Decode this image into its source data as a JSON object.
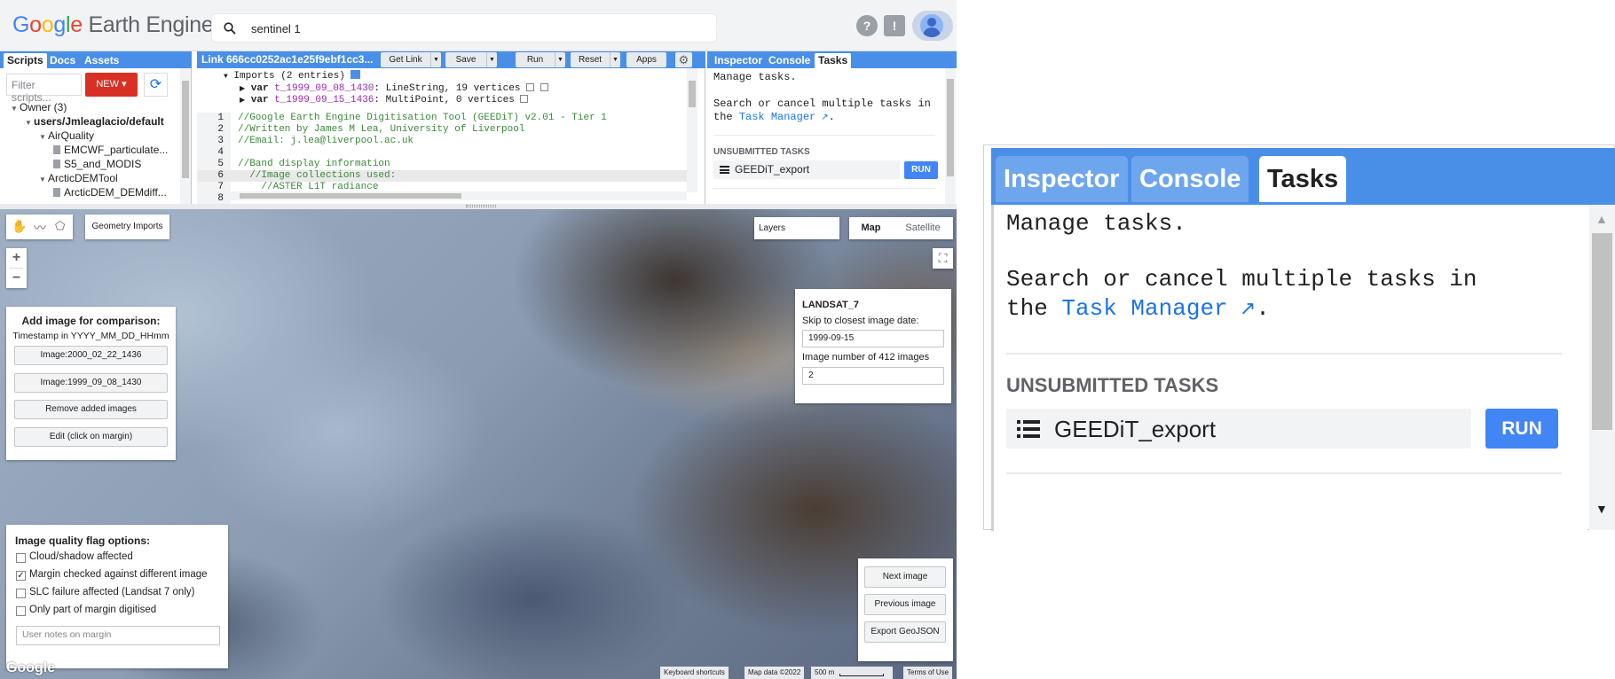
{
  "header": {
    "logo_google": [
      "G",
      "o",
      "o",
      "g",
      "l",
      "e"
    ],
    "logo_product": "Earth Engine",
    "search_value": "sentinel 1",
    "help_icon": "?",
    "feedback_icon": "!"
  },
  "left_panel": {
    "tabs": [
      "Scripts",
      "Docs",
      "Assets"
    ],
    "active_tab": "Scripts",
    "filter_placeholder": "Filter scripts...",
    "new_label": "NEW",
    "tree": [
      {
        "label": "Owner (3)",
        "type": "folder",
        "level": 0
      },
      {
        "label": "users/Jmleaglacio/default",
        "type": "folder",
        "level": 1
      },
      {
        "label": "AirQuality",
        "type": "folder",
        "level": 2
      },
      {
        "label": "EMCWF_particulate...",
        "type": "file",
        "level": 3
      },
      {
        "label": "S5_and_MODIS",
        "type": "file",
        "level": 3
      },
      {
        "label": "ArcticDEMTool",
        "type": "folder",
        "level": 2
      },
      {
        "label": "ArcticDEM_DEMdiff...",
        "type": "file",
        "level": 3
      }
    ]
  },
  "editor": {
    "link_title": "Link 666cc0252ac1e25f9ebf1cc3...",
    "buttons": {
      "get_link": "Get Link",
      "save": "Save",
      "run": "Run",
      "reset": "Reset",
      "apps": "Apps"
    },
    "imports_header": "Imports (2 entries)",
    "imports": [
      {
        "kw": "var",
        "name": "t_1999_09_08_1430",
        "desc": ": LineString, 19 vertices"
      },
      {
        "kw": "var",
        "name": "t_1999_09_15_1436",
        "desc": ": MultiPoint, 0 vertices"
      }
    ],
    "lines": [
      {
        "n": "1",
        "text": "//Google Earth Engine Digitisation Tool (GEEDiT) v2.01 - Tier 1"
      },
      {
        "n": "2",
        "text": "//Written by James M Lea, University of Liverpool"
      },
      {
        "n": "3",
        "text": "//Email: j.lea@liverpool.ac.uk"
      },
      {
        "n": "4",
        "text": ""
      },
      {
        "n": "5",
        "text": "//Band display information"
      },
      {
        "n": "6",
        "text": "  //Image collections used:"
      },
      {
        "n": "7",
        "text": "    //ASTER L1T radiance"
      },
      {
        "n": "8",
        "text": ""
      }
    ]
  },
  "right_panel": {
    "tabs": [
      "Inspector",
      "Console",
      "Tasks"
    ],
    "active_tab": "Tasks",
    "manage": "Manage tasks.",
    "search_line1": "Search or cancel multiple tasks in",
    "search_line2_prefix": "the ",
    "task_manager": "Task Manager",
    "search_line2_suffix": ".",
    "unsubmitted": "UNSUBMITTED TASKS",
    "task_name": "GEEDiT_export",
    "run_label": "RUN"
  },
  "map": {
    "geometry_imports": "Geometry Imports",
    "layers": "Layers",
    "map_type_map": "Map",
    "map_type_satellite": "Satellite",
    "zoom_in": "+",
    "zoom_out": "−",
    "compare": {
      "title": "Add image for comparison:",
      "subtitle": "Timestamp in YYYY_MM_DD_HHmm",
      "buttons": [
        "Image:2000_02_22_1436",
        "Image:1999_09_08_1430",
        "Remove added images",
        "Edit (click on margin)"
      ]
    },
    "landsat": {
      "title": "LANDSAT_7",
      "skip_label": "Skip to closest image date:",
      "date_value": "1999-09-15",
      "image_number_label": "Image number of 412 images",
      "image_number_value": "2"
    },
    "quality": {
      "title": "Image quality flag options:",
      "options": [
        {
          "label": "Cloud/shadow affected",
          "checked": false
        },
        {
          "label": "Margin checked against different image",
          "checked": true
        },
        {
          "label": "SLC failure affected (Landsat 7 only)",
          "checked": false
        },
        {
          "label": "Only part of margin digitised",
          "checked": false
        }
      ],
      "notes_placeholder": "User notes on margin"
    },
    "nav_buttons": [
      "Next image",
      "Previous image",
      "Export GeoJSON"
    ],
    "google_logo": "Google",
    "attribution": {
      "shortcuts": "Keyboard shortcuts",
      "data": "Map data ©2022",
      "scale": "500 m",
      "terms": "Terms of Use"
    }
  },
  "colors": {
    "accent_blue": "#4a8fe7",
    "run_blue": "#4285f4",
    "new_red": "#d93025",
    "comment_green": "#3a8a3a",
    "var_purple": "#9c27b0"
  }
}
